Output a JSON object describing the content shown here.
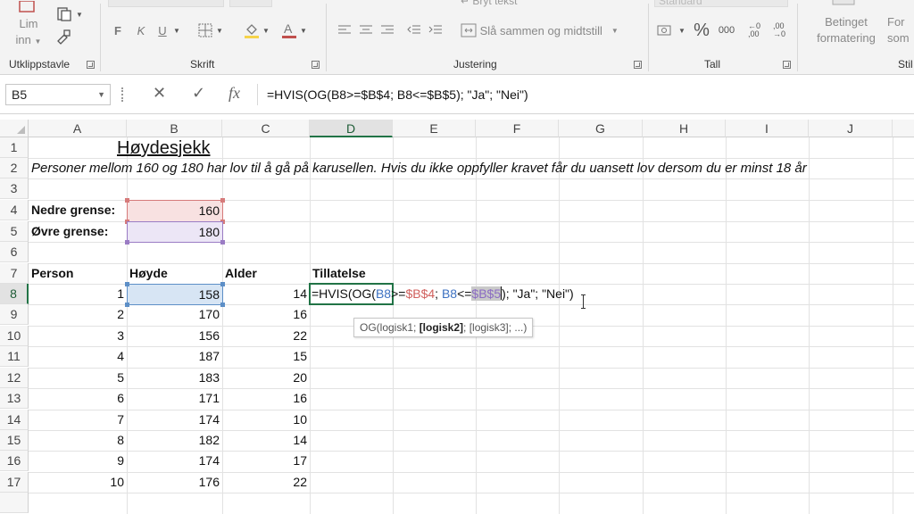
{
  "ribbon": {
    "clipboard": {
      "paste_top": "Lim",
      "paste_bottom": "inn",
      "label": "Utklippstavle"
    },
    "font": {
      "bold": "F",
      "italic": "K",
      "underline": "U",
      "label": "Skrift"
    },
    "alignment": {
      "wrap_text": "Bryt tekst",
      "merge_label": "Slå sammen og midtstill",
      "label": "Justering"
    },
    "number": {
      "format_value": "Standard",
      "percent": "%",
      "thousands": "000",
      "label": "Tall"
    },
    "styles": {
      "conditional_top": "Betinget",
      "conditional_bottom": "formatering",
      "format_top": "For",
      "format_bottom": "som",
      "label": "Stil"
    }
  },
  "formula_bar": {
    "name_box": "B5",
    "cancel": "✕",
    "enter": "✓",
    "fx": "fx",
    "formula": "=HVIS(OG(B8>=$B$4; B8<=$B$5); \"Ja\"; \"Nei\")"
  },
  "columns": [
    "A",
    "B",
    "C",
    "D",
    "E",
    "F",
    "G",
    "H",
    "I",
    "J"
  ],
  "rows": [
    "1",
    "2",
    "3",
    "4",
    "5",
    "6",
    "7",
    "8",
    "9",
    "10",
    "11",
    "12",
    "13",
    "14",
    "15",
    "16",
    "17"
  ],
  "sheet": {
    "title": "Høydesjekk",
    "description": "Personer mellom 160 og 180 har lov til å gå på karusellen. Hvis du ikke oppfyller kravet får du uansett lov dersom du er minst 18 år",
    "lower_label": "Nedre grense:",
    "lower_value": "160",
    "upper_label": "Øvre grense:",
    "upper_value": "180",
    "headers": {
      "person": "Person",
      "height": "Høyde",
      "age": "Alder",
      "permission": "Tillatelse"
    },
    "data": [
      [
        "1",
        "158",
        "14"
      ],
      [
        "2",
        "170",
        "16"
      ],
      [
        "3",
        "156",
        "22"
      ],
      [
        "4",
        "187",
        "15"
      ],
      [
        "5",
        "183",
        "20"
      ],
      [
        "6",
        "171",
        "16"
      ],
      [
        "7",
        "174",
        "10"
      ],
      [
        "8",
        "182",
        "14"
      ],
      [
        "9",
        "174",
        "17"
      ],
      [
        "10",
        "176",
        "22"
      ]
    ]
  },
  "edit": {
    "p1": "=HVIS(OG(",
    "p2": "B8",
    "p3": ">=",
    "p4": "$B$4",
    "p5": "; ",
    "p6": "B8",
    "p7": "<=",
    "p8": "$B$5",
    "p9": "); \"Ja\"; \"Nei\")"
  },
  "tooltip": {
    "fn": "OG(logisk1; ",
    "current": "[logisk2]",
    "rest": "; [logisk3]; ...)"
  },
  "colors": {
    "excel_green": "#217346",
    "ref_red": "#d0605d",
    "ref_purple": "#8b6cc2",
    "ref_blue": "#3e72c2"
  }
}
